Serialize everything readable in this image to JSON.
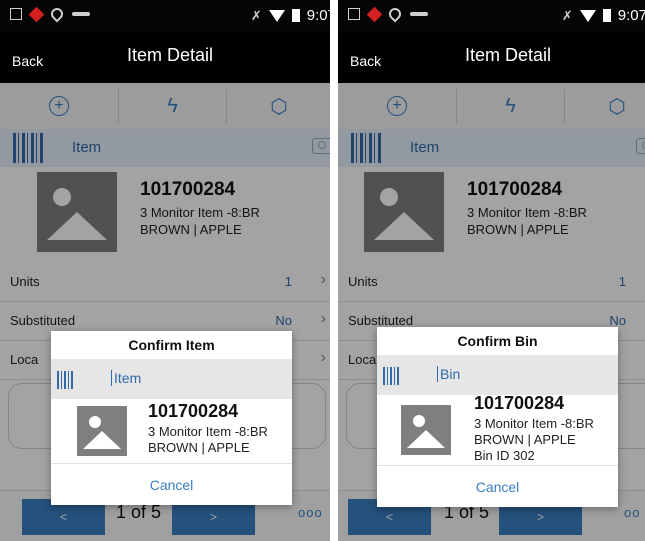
{
  "status_bar": {
    "time": "9:07"
  },
  "screens": [
    {
      "title": "Item Detail",
      "back_label": "Back",
      "scan_label": "Item",
      "item": {
        "id": "101700284",
        "desc": "3 Monitor Item -8:BR",
        "attrs": "BROWN | APPLE"
      },
      "rows": [
        {
          "label": "Units",
          "value": "1"
        },
        {
          "label": "Substituted",
          "value": "No"
        },
        {
          "label": "Loca",
          "value": ""
        }
      ],
      "pager": "1 of 5",
      "prev_label": "<",
      "next_label": ">",
      "more_label": "ooo",
      "dialog": {
        "title": "Confirm Item",
        "placeholder": "Item",
        "item_id": "101700284",
        "lines": [
          "3 Monitor Item -8:BR",
          "BROWN | APPLE"
        ],
        "cancel_label": "Cancel"
      }
    },
    {
      "title": "Item Detail",
      "back_label": "Back",
      "scan_label": "Item",
      "item": {
        "id": "101700284",
        "desc": "3 Monitor Item -8:BR",
        "attrs": "BROWN | APPLE"
      },
      "rows": [
        {
          "label": "Units",
          "value": "1"
        },
        {
          "label": "Substituted",
          "value": "No"
        },
        {
          "label": "Loca",
          "value": ""
        }
      ],
      "pager": "1 of 5",
      "prev_label": "<",
      "next_label": ">",
      "more_label": "oo",
      "dialog": {
        "title": "Confirm Bin",
        "placeholder": "Bin",
        "item_id": "101700284",
        "lines": [
          "3 Monitor Item -8:BR",
          "BROWN | APPLE",
          "Bin ID 302"
        ],
        "cancel_label": "Cancel"
      }
    }
  ],
  "colors": {
    "accent": "#3a7fc4",
    "title_bar": "#000000",
    "overlay": "#5c5c5c"
  },
  "icons": [
    "image-icon",
    "alert-icon",
    "wifi-question-icon",
    "key-icon",
    "mute-icon",
    "wifi-icon",
    "battery-icon",
    "add-icon",
    "lightning-icon",
    "cube-icon",
    "barcode-icon",
    "camera-icon",
    "chevron-right-icon"
  ]
}
